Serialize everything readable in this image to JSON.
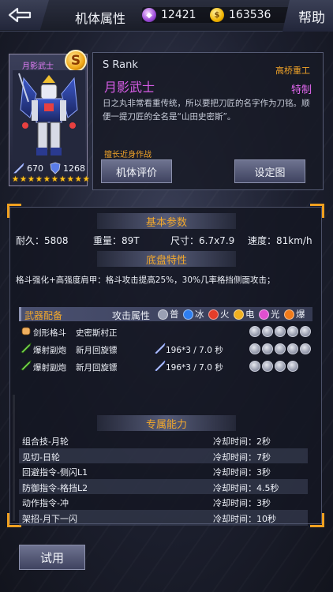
{
  "header": {
    "title": "机体属性",
    "diamond_value": "12421",
    "gold_value": "163536",
    "help_label": "帮助"
  },
  "card": {
    "name": "月影武士",
    "rank_badge": "S",
    "attack": "670",
    "defense": "1268",
    "stars": 10
  },
  "info": {
    "rank": "S Rank",
    "maker": "高桥重工",
    "unit_name": "月影武士",
    "custom_tag": "特制",
    "description": "日之丸非常看重传统，所以要把刀匠的名字作为刀铭。顺便一提刀匠的全名是“山田史密斯”。",
    "specialty": "擅长近身作战",
    "eval_button": "机体评价",
    "setting_button": "设定图"
  },
  "basic": {
    "title": "基本参数",
    "durability": "耐久：5808",
    "weight": "重量：89T",
    "size": "尺寸：6.7x7.9",
    "speed": "速度：81km/h"
  },
  "chassis": {
    "title": "底盘特性",
    "text": "格斗强化+高强度肩甲：格斗攻击提高25%，30%几率格挡侧面攻击；"
  },
  "weapons": {
    "header_label": "武器配备",
    "attr_label": "攻击属性",
    "elements": [
      {
        "label": "普",
        "color": "#9aa0b4"
      },
      {
        "label": "冰",
        "color": "#2e7ef0"
      },
      {
        "label": "火",
        "color": "#e53d2a"
      },
      {
        "label": "电",
        "color": "#f0b020"
      },
      {
        "label": "光",
        "color": "#e04fd0"
      },
      {
        "label": "爆",
        "color": "#f07a1a"
      }
    ],
    "rows": [
      {
        "type": "剑形格斗",
        "name": "史密斯村正",
        "damage": ""
      },
      {
        "type": "爆射副炮",
        "name": "新月回旋镖",
        "damage": "196*3 / 7.0 秒"
      },
      {
        "type": "爆射副炮",
        "name": "新月回旋镖",
        "damage": "196*3 / 7.0 秒"
      }
    ]
  },
  "abilities": {
    "title": "专属能力",
    "items": [
      {
        "name": "组合技-月轮",
        "cooldown": "冷却时间：2秒"
      },
      {
        "name": "见切-日轮",
        "cooldown": "冷却时间：7秒"
      },
      {
        "name": "回避指令-侧闪L1",
        "cooldown": "冷却时间：3秒"
      },
      {
        "name": "防御指令-格挡L2",
        "cooldown": "冷却时间：4.5秒"
      },
      {
        "name": "动作指令-冲",
        "cooldown": "冷却时间：3秒"
      },
      {
        "name": "架招-月下一闪",
        "cooldown": "冷却时间：10秒"
      }
    ]
  },
  "trial_button": "试用"
}
